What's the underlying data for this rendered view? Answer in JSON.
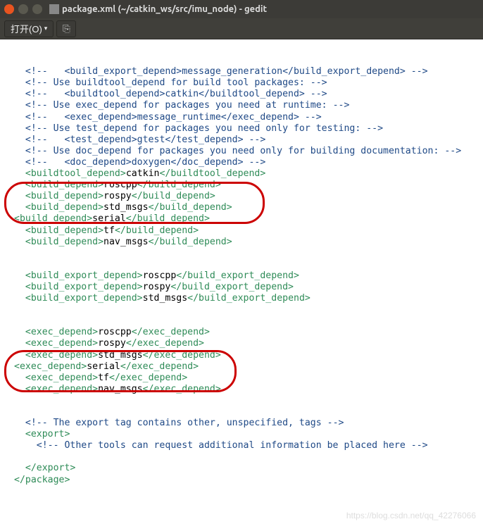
{
  "window": {
    "title": "package.xml (~/catkin_ws/src/imu_node) - gedit"
  },
  "toolbar": {
    "open_label": "打开(O)"
  },
  "code_lines": [
    {
      "indent": 1,
      "segs": [
        {
          "cls": "c-comment",
          "t": "<!--   <build_export_depend>message_generation</build_export_depend> -->"
        }
      ]
    },
    {
      "indent": 1,
      "segs": [
        {
          "cls": "c-comment",
          "t": "<!-- Use buildtool_depend for build tool packages: -->"
        }
      ]
    },
    {
      "indent": 1,
      "segs": [
        {
          "cls": "c-comment",
          "t": "<!--   <buildtool_depend>catkin</buildtool_depend> -->"
        }
      ]
    },
    {
      "indent": 1,
      "segs": [
        {
          "cls": "c-comment",
          "t": "<!-- Use exec_depend for packages you need at runtime: -->"
        }
      ]
    },
    {
      "indent": 1,
      "segs": [
        {
          "cls": "c-comment",
          "t": "<!--   <exec_depend>message_runtime</exec_depend> -->"
        }
      ]
    },
    {
      "indent": 1,
      "segs": [
        {
          "cls": "c-comment",
          "t": "<!-- Use test_depend for packages you need only for testing: -->"
        }
      ]
    },
    {
      "indent": 1,
      "segs": [
        {
          "cls": "c-comment",
          "t": "<!--   <test_depend>gtest</test_depend> -->"
        }
      ]
    },
    {
      "indent": 1,
      "segs": [
        {
          "cls": "c-comment",
          "t": "<!-- Use doc_depend for packages you need only for building documentation: -->"
        }
      ]
    },
    {
      "indent": 1,
      "segs": [
        {
          "cls": "c-comment",
          "t": "<!--   <doc_depend>doxygen</doc_depend> -->"
        }
      ]
    },
    {
      "indent": 1,
      "segs": [
        {
          "cls": "c-tag",
          "t": "<buildtool_depend>"
        },
        {
          "cls": "c-text",
          "t": "catkin"
        },
        {
          "cls": "c-tag",
          "t": "</buildtool_depend>"
        }
      ]
    },
    {
      "indent": 1,
      "segs": [
        {
          "cls": "c-tag",
          "t": "<build_depend>"
        },
        {
          "cls": "c-text",
          "t": "roscpp"
        },
        {
          "cls": "c-tag",
          "t": "</build_depend>"
        }
      ]
    },
    {
      "indent": 1,
      "segs": [
        {
          "cls": "c-tag",
          "t": "<build_depend>"
        },
        {
          "cls": "c-text",
          "t": "rospy"
        },
        {
          "cls": "c-tag",
          "t": "</build_depend>"
        }
      ]
    },
    {
      "indent": 1,
      "segs": [
        {
          "cls": "c-tag",
          "t": "<build_depend>"
        },
        {
          "cls": "c-text",
          "t": "std_msgs"
        },
        {
          "cls": "c-tag",
          "t": "</build_depend>"
        }
      ]
    },
    {
      "indent": 0,
      "segs": [
        {
          "cls": "c-tag",
          "t": "<build_depend>"
        },
        {
          "cls": "c-text",
          "t": "serial"
        },
        {
          "cls": "c-tag",
          "t": "</build_depend>"
        }
      ]
    },
    {
      "indent": 1,
      "segs": [
        {
          "cls": "c-tag",
          "t": "<build_depend>"
        },
        {
          "cls": "c-text",
          "t": "tf"
        },
        {
          "cls": "c-tag",
          "t": "</build_depend>"
        }
      ]
    },
    {
      "indent": 1,
      "segs": [
        {
          "cls": "c-tag",
          "t": "<build_depend>"
        },
        {
          "cls": "c-text",
          "t": "nav_msgs"
        },
        {
          "cls": "c-tag",
          "t": "</build_depend>"
        }
      ]
    },
    {
      "indent": 0,
      "segs": []
    },
    {
      "indent": 0,
      "segs": []
    },
    {
      "indent": 1,
      "segs": [
        {
          "cls": "c-tag",
          "t": "<build_export_depend>"
        },
        {
          "cls": "c-text",
          "t": "roscpp"
        },
        {
          "cls": "c-tag",
          "t": "</build_export_depend>"
        }
      ]
    },
    {
      "indent": 1,
      "segs": [
        {
          "cls": "c-tag",
          "t": "<build_export_depend>"
        },
        {
          "cls": "c-text",
          "t": "rospy"
        },
        {
          "cls": "c-tag",
          "t": "</build_export_depend>"
        }
      ]
    },
    {
      "indent": 1,
      "segs": [
        {
          "cls": "c-tag",
          "t": "<build_export_depend>"
        },
        {
          "cls": "c-text",
          "t": "std_msgs"
        },
        {
          "cls": "c-tag",
          "t": "</build_export_depend>"
        }
      ]
    },
    {
      "indent": 0,
      "segs": []
    },
    {
      "indent": 0,
      "segs": []
    },
    {
      "indent": 1,
      "segs": [
        {
          "cls": "c-tag",
          "t": "<exec_depend>"
        },
        {
          "cls": "c-text",
          "t": "roscpp"
        },
        {
          "cls": "c-tag",
          "t": "</exec_depend>"
        }
      ]
    },
    {
      "indent": 1,
      "segs": [
        {
          "cls": "c-tag",
          "t": "<exec_depend>"
        },
        {
          "cls": "c-text",
          "t": "rospy"
        },
        {
          "cls": "c-tag",
          "t": "</exec_depend>"
        }
      ]
    },
    {
      "indent": 1,
      "segs": [
        {
          "cls": "c-tag",
          "t": "<exec_depend>"
        },
        {
          "cls": "c-text",
          "t": "std_msgs"
        },
        {
          "cls": "c-tag",
          "t": "</exec_depend>"
        }
      ]
    },
    {
      "indent": 0,
      "segs": [
        {
          "cls": "c-tag",
          "t": "<exec_depend>"
        },
        {
          "cls": "c-text",
          "t": "serial"
        },
        {
          "cls": "c-tag",
          "t": "</exec_depend>"
        }
      ]
    },
    {
      "indent": 1,
      "segs": [
        {
          "cls": "c-tag",
          "t": "<exec_depend>"
        },
        {
          "cls": "c-text",
          "t": "tf"
        },
        {
          "cls": "c-tag",
          "t": "</exec_depend>"
        }
      ]
    },
    {
      "indent": 1,
      "segs": [
        {
          "cls": "c-tag",
          "t": "<exec_depend>"
        },
        {
          "cls": "c-text",
          "t": "nav_msgs"
        },
        {
          "cls": "c-tag",
          "t": "</exec_depend>"
        }
      ]
    },
    {
      "indent": 0,
      "segs": []
    },
    {
      "indent": 0,
      "segs": []
    },
    {
      "indent": 1,
      "segs": [
        {
          "cls": "c-comment",
          "t": "<!-- The export tag contains other, unspecified, tags -->"
        }
      ]
    },
    {
      "indent": 1,
      "segs": [
        {
          "cls": "c-tag",
          "t": "<export>"
        }
      ]
    },
    {
      "indent": 2,
      "segs": [
        {
          "cls": "c-comment",
          "t": "<!-- Other tools can request additional information be placed here -->"
        }
      ]
    },
    {
      "indent": 0,
      "segs": []
    },
    {
      "indent": 1,
      "segs": [
        {
          "cls": "c-tag",
          "t": "</export>"
        }
      ]
    },
    {
      "indent": 0,
      "segs": [
        {
          "cls": "c-tag",
          "t": "</package>"
        }
      ]
    }
  ],
  "watermark": "https://blog.csdn.net/qq_42276066"
}
